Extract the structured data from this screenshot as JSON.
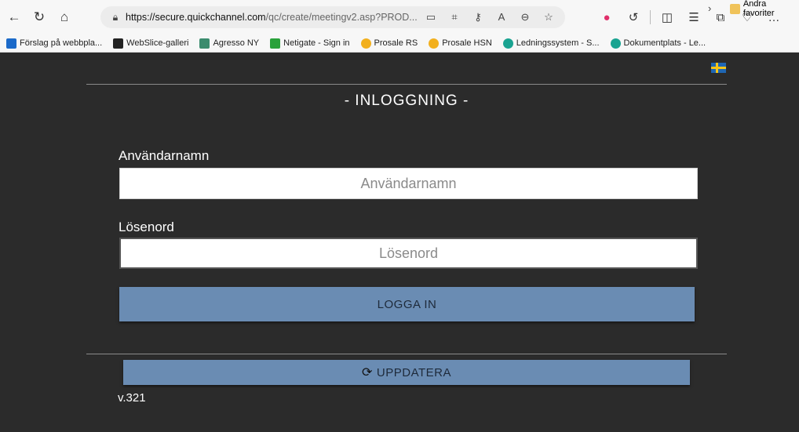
{
  "browser": {
    "url_host": "https://secure.quickchannel.com",
    "url_path": "/qc/create/meetingv2.asp?PROD...",
    "icons": [
      "back-icon",
      "refresh-icon",
      "home-icon",
      "lock-icon",
      "reader-icon",
      "grid-icon",
      "key-icon",
      "read-aloud-icon",
      "zoom-icon",
      "favorite-star-icon"
    ]
  },
  "favorites": [
    {
      "label": "Förslag på webbpla...",
      "icon": "bing"
    },
    {
      "label": "WebSlice-galleri",
      "icon": "web"
    },
    {
      "label": "Agresso NY",
      "icon": "agr"
    },
    {
      "label": "Netigate - Sign in",
      "icon": "netg"
    },
    {
      "label": "Prosale RS",
      "icon": "pros"
    },
    {
      "label": "Prosale HSN",
      "icon": "pros"
    },
    {
      "label": "Ledningssystem - S...",
      "icon": "led"
    },
    {
      "label": "Dokumentplats - Le...",
      "icon": "led"
    }
  ],
  "favorites_other": "Andra favoriter",
  "login": {
    "title": "- INLOGGNING -",
    "username_label": "Användarnamn",
    "username_placeholder": "Användarnamn",
    "password_label": "Lösenord",
    "password_placeholder": "Lösenord",
    "login_button": "LOGGA IN",
    "update_button": "UPPDATERA",
    "version": "v.321"
  },
  "colors": {
    "background": "#2b2b2b",
    "button": "#6a8cb3"
  }
}
